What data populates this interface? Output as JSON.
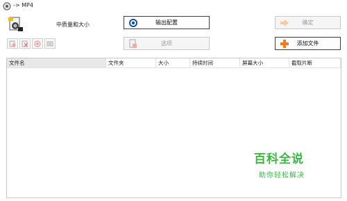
{
  "window": {
    "title": "-> MP4"
  },
  "preset": {
    "label": "中质量和大小"
  },
  "buttons": {
    "output_settings": "输出配置",
    "ok": "确定",
    "options": "选项",
    "add_file": "添加文件"
  },
  "list": {
    "columns": [
      "文件名",
      "文件夹",
      "大小",
      "持续时间",
      "屏幕大小",
      "截取片断"
    ],
    "rows": []
  },
  "watermark": {
    "title": "百科全说",
    "subtitle": "助你轻松解决"
  },
  "colors": {
    "accent_orange": "#f07d1a",
    "watermark_green": "#3cb544",
    "header_highlight": "#e8e8e8"
  }
}
